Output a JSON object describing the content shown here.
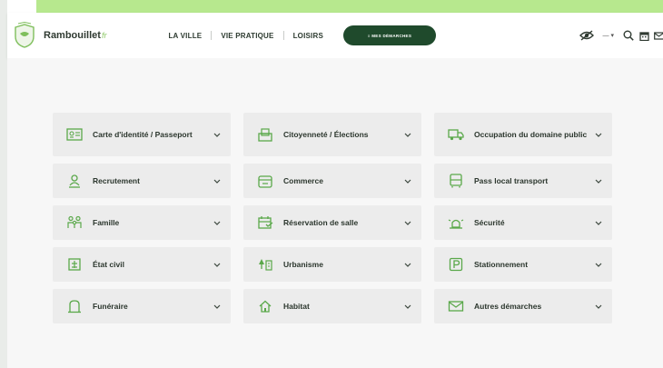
{
  "header": {
    "logo_text": "Rambouillet",
    "logo_suffix": "fr",
    "nav": [
      {
        "label": "LA VILLE"
      },
      {
        "label": "VIE PRATIQUE"
      },
      {
        "label": "LOISIRS"
      }
    ],
    "cta_label": "≡ MES DÉMARCHES",
    "lang_label": "— ▾"
  },
  "colors": {
    "accent": "#b7e88e",
    "brand": "#1f4a2c",
    "icon": "#5aa84a"
  },
  "demarches": [
    {
      "label": "Carte d'identité / Passeport",
      "icon": "id-card-icon"
    },
    {
      "label": "Citoyenneté / Élections",
      "icon": "ballot-icon"
    },
    {
      "label": "Occupation du domaine public",
      "icon": "truck-icon"
    },
    {
      "label": "Recrutement",
      "icon": "person-icon"
    },
    {
      "label": "Commerce",
      "icon": "shop-icon"
    },
    {
      "label": "Pass local transport",
      "icon": "bus-icon"
    },
    {
      "label": "Famille",
      "icon": "family-icon"
    },
    {
      "label": "Réservation de salle",
      "icon": "calendar-icon"
    },
    {
      "label": "Sécurité",
      "icon": "siren-icon"
    },
    {
      "label": "État civil",
      "icon": "document-icon"
    },
    {
      "label": "Urbanisme",
      "icon": "trees-icon"
    },
    {
      "label": "Stationnement",
      "icon": "parking-icon"
    },
    {
      "label": "Funéraire",
      "icon": "tomb-icon"
    },
    {
      "label": "Habitat",
      "icon": "house-icon"
    },
    {
      "label": "Autres démarches",
      "icon": "mail-icon"
    }
  ]
}
